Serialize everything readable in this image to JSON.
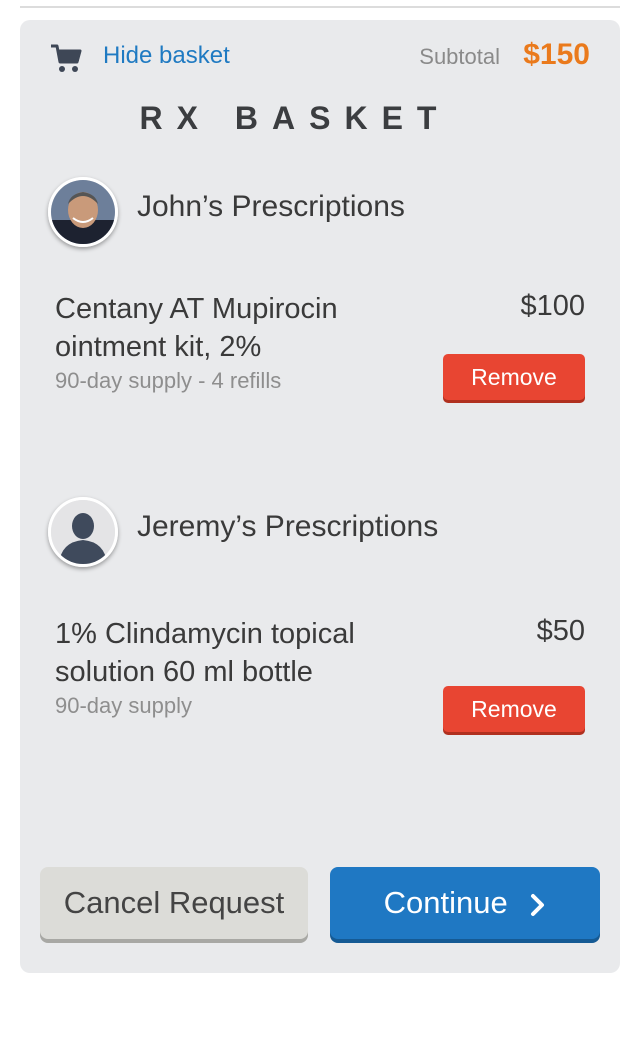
{
  "header": {
    "hide_basket": "Hide basket",
    "subtotal_label": "Subtotal",
    "subtotal_value": "$150",
    "title": "RX BASKET"
  },
  "people": [
    {
      "name": "John’s Prescriptions",
      "item": {
        "name": "Centany AT Mupirocin ointment kit, 2%",
        "supply": "90-day supply - 4 refills",
        "price": "$100",
        "remove_label": "Remove"
      }
    },
    {
      "name": "Jeremy’s Prescriptions",
      "item": {
        "name": "1% Clindamycin topical solution 60 ml bottle",
        "supply": "90-day supply",
        "price": "$50",
        "remove_label": "Remove"
      }
    }
  ],
  "actions": {
    "cancel_label": "Cancel Request",
    "continue_label": "Continue",
    "continue_icon": "chevron-right-icon"
  },
  "colors": {
    "accent": "#1f78c3",
    "price_accent": "#ea7a1c",
    "remove": "#e84532",
    "panel": "#e9eaec"
  }
}
